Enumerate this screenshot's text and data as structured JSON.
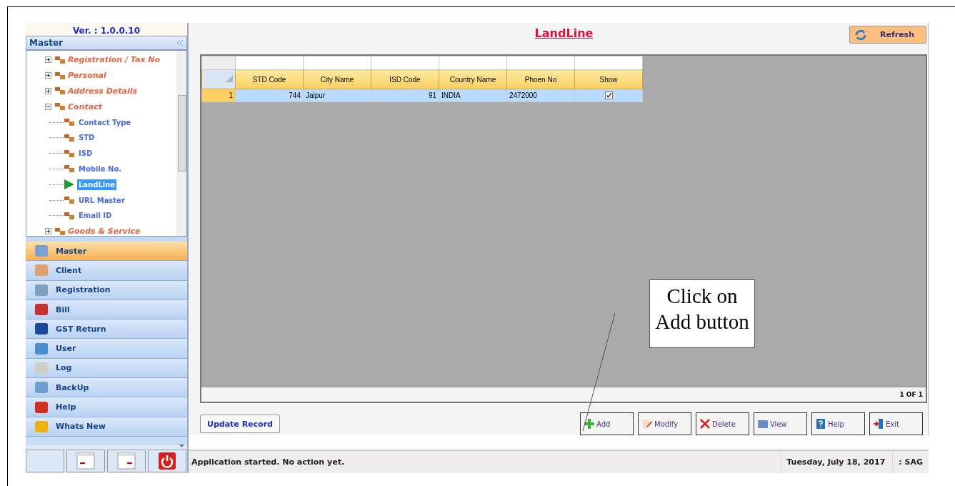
{
  "sidebar": {
    "version": "Ver. : 1.0.0.10",
    "panel_title": "Master",
    "tree": [
      {
        "label": "Registration / Tax No",
        "expanded": false
      },
      {
        "label": "Personal",
        "expanded": false
      },
      {
        "label": "Address Details",
        "expanded": false
      },
      {
        "label": "Contact",
        "expanded": true,
        "children": [
          {
            "label": "Contact Type",
            "selected": false
          },
          {
            "label": "STD",
            "selected": false
          },
          {
            "label": "ISD",
            "selected": false
          },
          {
            "label": "Mobile No.",
            "selected": false
          },
          {
            "label": "LandLine",
            "selected": true
          },
          {
            "label": "URL Master",
            "selected": false
          },
          {
            "label": "Email ID",
            "selected": false
          }
        ]
      },
      {
        "label": "Goods & Service",
        "expanded": false
      }
    ],
    "nav": [
      {
        "label": "Master",
        "selected": true
      },
      {
        "label": "Client",
        "selected": false
      },
      {
        "label": "Registration",
        "selected": false
      },
      {
        "label": "Bill",
        "selected": false
      },
      {
        "label": "GST Return",
        "selected": false
      },
      {
        "label": "User",
        "selected": false
      },
      {
        "label": "Log",
        "selected": false
      },
      {
        "label": "BackUp",
        "selected": false
      },
      {
        "label": "Help",
        "selected": false
      },
      {
        "label": "Whats New",
        "selected": false
      }
    ]
  },
  "main": {
    "title": "LandLine",
    "refresh": "Refresh",
    "table": {
      "columns": [
        "STD Code",
        "City Name",
        "ISD Code",
        "Country Name",
        "Phoen No",
        "Show"
      ],
      "rows": [
        {
          "number": "1",
          "selected": true,
          "cells": [
            "744",
            "Jaipur",
            "91",
            "INDIA",
            "2472000"
          ],
          "show": true
        }
      ]
    },
    "pager": "1 OF 1",
    "update_button": "Update Record",
    "actions": [
      "Add",
      "Modify",
      "Delete",
      "View",
      "Help",
      "Exit"
    ],
    "callout": "Click on Add button"
  },
  "status_bar": {
    "message": "Application started. No action yet.",
    "date": "Tuesday, July 18, 2017",
    "user": ": SAG"
  }
}
